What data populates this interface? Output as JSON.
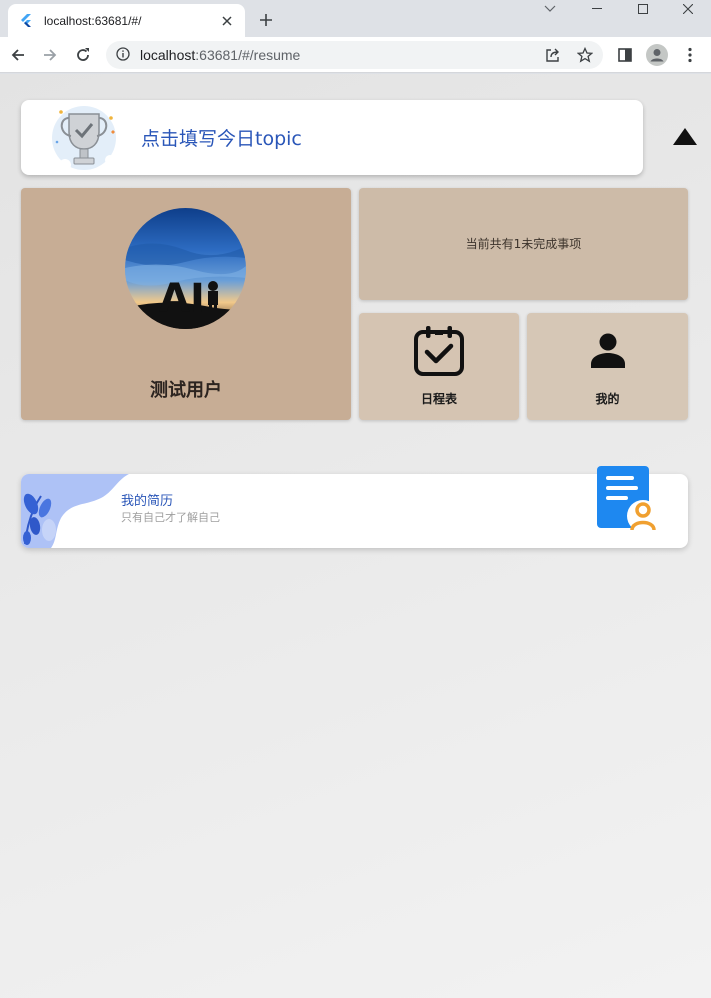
{
  "browser": {
    "tab_title": "localhost:63681/#/",
    "url_host": "localhost",
    "url_rest": ":63681/#/resume"
  },
  "topic_card": {
    "text": "点击填写今日topic"
  },
  "user_tile": {
    "name": "测试用户"
  },
  "todo_tile": {
    "text": "当前共有1未完成事项"
  },
  "schedule_tile": {
    "label": "日程表",
    "icon": "calendar-check-icon"
  },
  "me_tile": {
    "label": "我的",
    "icon": "person-icon"
  },
  "resume_card": {
    "title": "我的简历",
    "subtitle": "只有自己才了解自己",
    "icon": "resume-user-icon"
  },
  "colors": {
    "accent_text": "#2a56b8",
    "user_tile": "#c7ad95",
    "todo_tile": "#cdbba8",
    "schedule_tile": "#d5c4b2",
    "me_tile": "#d6c7b6",
    "resume_doc": "#1e88f0",
    "resume_person": "#f0a030"
  }
}
